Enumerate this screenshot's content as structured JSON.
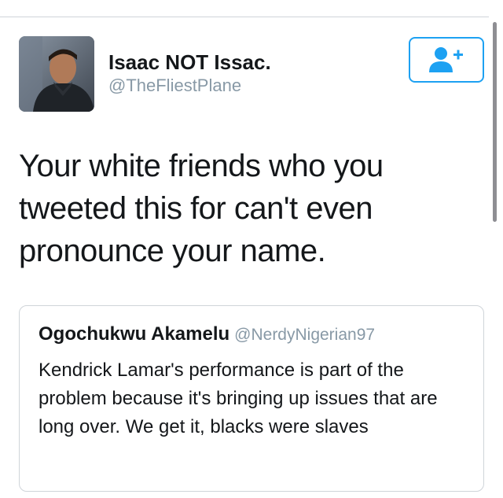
{
  "tweet": {
    "author": {
      "display_name": "Isaac NOT Issac.",
      "handle": "@TheFliestPlane",
      "avatar_icon": "profile-photo"
    },
    "follow_button": {
      "icon": "add-user-icon",
      "accent_color": "#1da1f2"
    },
    "text": "Your white friends who you tweeted this for can't even pronounce your name.",
    "quoted_tweet": {
      "display_name": "Ogochukwu Akamelu",
      "handle": "@NerdyNigerian97",
      "text": "Kendrick Lamar's performance is part of the problem because it's bringing up issues that are long over. We get it, blacks were slaves"
    }
  },
  "colors": {
    "text_primary": "#14171a",
    "text_secondary": "#8899a6",
    "border": "#cfd4d9",
    "accent": "#1da1f2"
  }
}
